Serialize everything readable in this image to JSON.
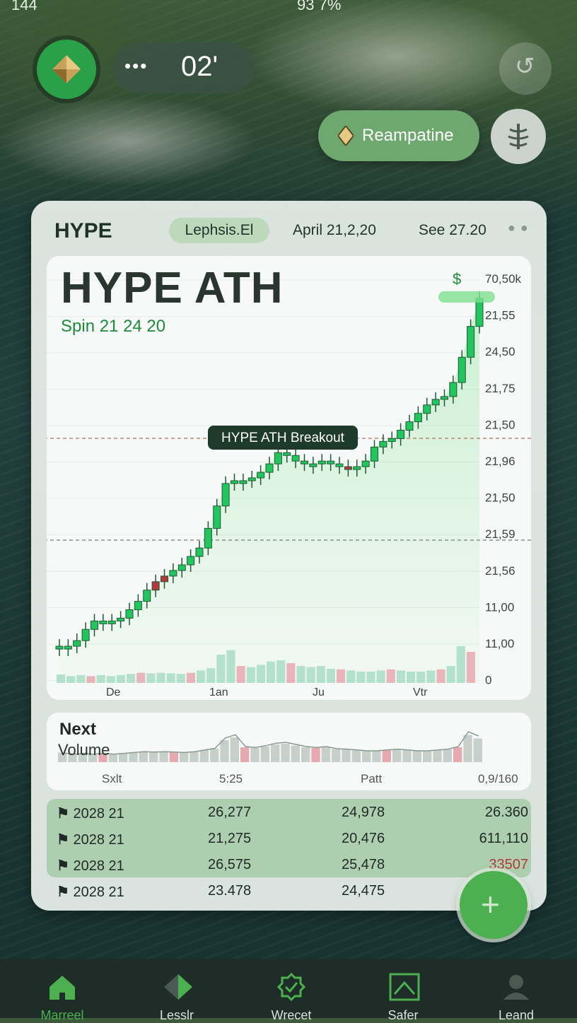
{
  "status_bar": {
    "left": "144",
    "right": "93   7%"
  },
  "top": {
    "timer_dots": "•••",
    "timer_value": "02'"
  },
  "pill_button": {
    "label": "Reampatine"
  },
  "card": {
    "symbol": "HYPE",
    "chip": "Lephsis.El",
    "date1": "April 21,2,20",
    "date2": "See 27.20"
  },
  "chart": {
    "title": "HYPE ATH",
    "subtitle": "Spin 21 24 20",
    "price_label": "$",
    "annotation": "HYPE ATH Breakout",
    "accent": "#22c55e",
    "down_color": "#b33a3a"
  },
  "chart_data": {
    "type": "bar",
    "title": "HYPE ATH",
    "subtitle": "Spin 21 24 20",
    "x_ticks": [
      "De",
      "1an",
      "Ju",
      "Vtr"
    ],
    "y_ticks": [
      "70,50k",
      "21,55",
      "24,50",
      "21,75",
      "21,50",
      "21,96",
      "21,50",
      "21,59",
      "21,56",
      "11,00",
      "11,00",
      "0"
    ],
    "annotations": [
      "HYPE ATH Breakout"
    ],
    "series": [
      {
        "values": [
          0.02,
          0.02,
          0.04,
          0.08,
          0.11,
          0.11,
          0.11,
          0.12,
          0.15,
          0.18,
          0.22,
          0.25,
          0.27,
          0.29,
          0.31,
          0.34,
          0.37,
          0.44,
          0.52,
          0.6,
          0.61,
          0.61,
          0.62,
          0.64,
          0.67,
          0.71,
          0.7,
          0.68,
          0.67,
          0.67,
          0.68,
          0.67,
          0.66,
          0.65,
          0.66,
          0.68,
          0.73,
          0.75,
          0.76,
          0.79,
          0.82,
          0.85,
          0.88,
          0.9,
          0.91,
          0.96,
          1.05,
          1.16,
          1.26
        ]
      }
    ],
    "volume": [
      0.15,
      0.12,
      0.14,
      0.12,
      0.14,
      0.12,
      0.14,
      0.16,
      0.18,
      0.17,
      0.18,
      0.17,
      0.16,
      0.18,
      0.22,
      0.26,
      0.5,
      0.58,
      0.3,
      0.28,
      0.32,
      0.38,
      0.4,
      0.35,
      0.3,
      0.28,
      0.3,
      0.25,
      0.24,
      0.22,
      0.2,
      0.2,
      0.22,
      0.24,
      0.22,
      0.2,
      0.2,
      0.22,
      0.24,
      0.3,
      0.65,
      0.55
    ]
  },
  "volume_panel": {
    "title": "Next",
    "subtitle": "Volume",
    "x_labels": [
      "Sxlt",
      "5:25",
      "Patt",
      "0,9/160"
    ]
  },
  "table": {
    "rows": [
      {
        "icon": "⚑",
        "date": "2028 21",
        "a": "26,277",
        "b": "24,978",
        "c": "26.360",
        "c_color": "#1f2a25",
        "highlight": true
      },
      {
        "icon": "⚑",
        "date": "2028 21",
        "a": "21,275",
        "b": "20,476",
        "c": "611,110",
        "c_color": "#1f2a25",
        "highlight": true
      },
      {
        "icon": "⚑",
        "date": "2028 21",
        "a": "26,575",
        "b": "25,478",
        "c": "33507",
        "c_color": "#b33a3a",
        "highlight": true
      },
      {
        "icon": "⚑",
        "date": "2028 21",
        "a": "23.478",
        "b": "24,475",
        "c": "",
        "c_color": "#1f2a25",
        "highlight": false
      }
    ]
  },
  "nav": {
    "items": [
      {
        "label": "Marreel",
        "icon": "home-icon"
      },
      {
        "label": "Lesslr",
        "icon": "diamond-icon"
      },
      {
        "label": "Wrecet",
        "icon": "badge-check-icon"
      },
      {
        "label": "Safer",
        "icon": "chart-frame-icon"
      },
      {
        "label": "Leand",
        "icon": "profile-icon"
      }
    ]
  }
}
